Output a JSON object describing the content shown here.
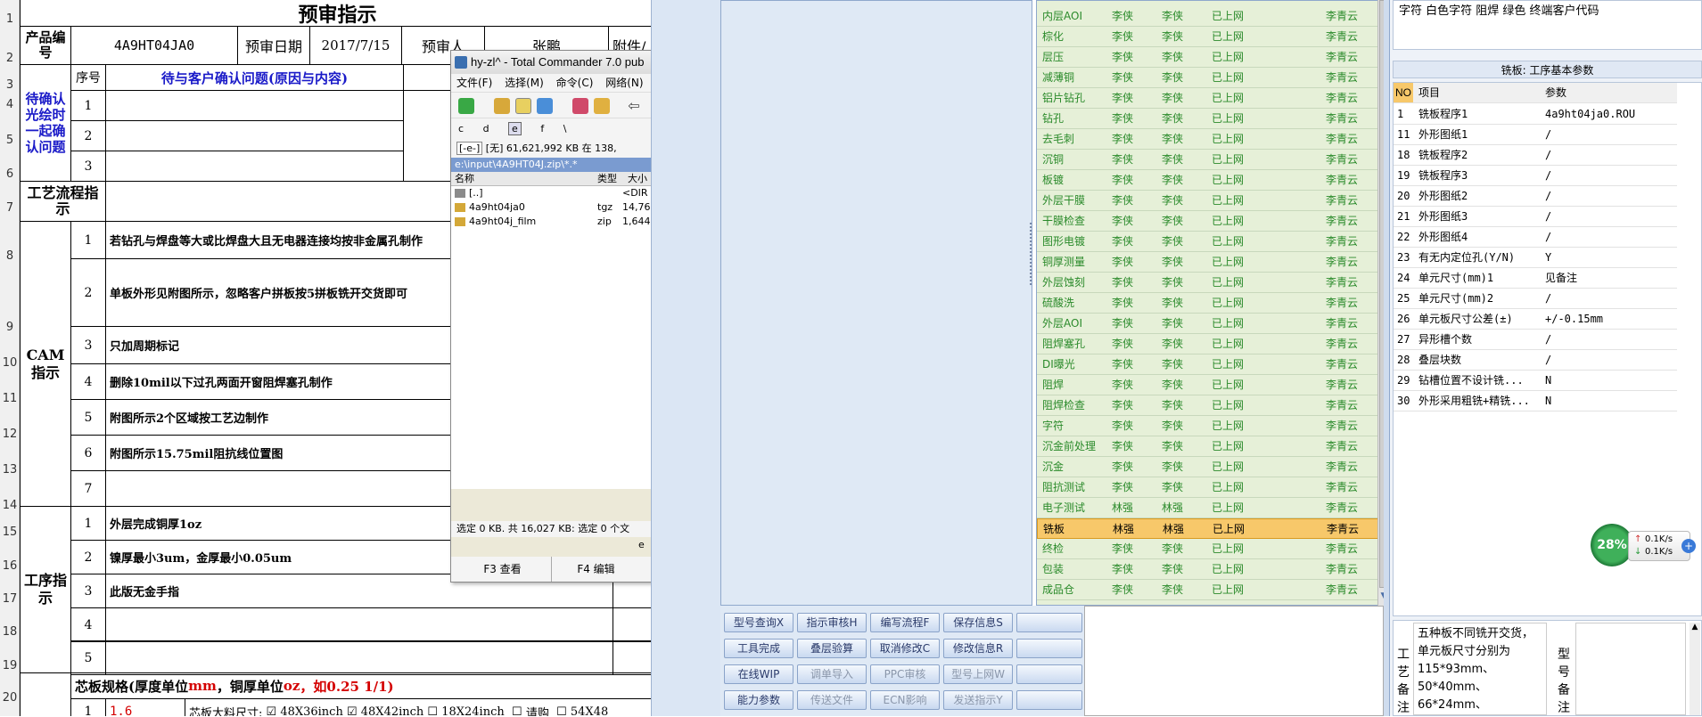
{
  "sheet": {
    "title": "预审指示",
    "row_numbers": [
      "1",
      "2",
      "3",
      "4",
      "5",
      "6",
      "7",
      "8",
      "9",
      "10",
      "11",
      "12",
      "13",
      "14",
      "15",
      "16",
      "17",
      "18",
      "19",
      "20"
    ],
    "header": {
      "product_label": "产品编号",
      "product_value": "4A9HT04JA0",
      "date_label": "预审日期",
      "date_value": "2017/7/15",
      "reviewer_label": "预审人",
      "reviewer_value": "张鹏",
      "attachment_label": "附件/"
    },
    "confirm": {
      "section_label": "待确认光绘时一起确认问题",
      "seq_label": "序号",
      "issues_label": "待与客户确认问题(原因与内容)",
      "rows": [
        "1",
        "2",
        "3"
      ]
    },
    "flow_label": "工艺流程指示",
    "cam": {
      "label": "CAM指示",
      "items": [
        {
          "no": "1",
          "text": "若钻孔与焊盘等大或比焊盘大且无电器连接均按非金属孔制作"
        },
        {
          "no": "2",
          "text": "单板外形见附图所示，忽略客户拼板按5拼板铣开交货即可"
        },
        {
          "no": "3",
          "text": "只加周期标记"
        },
        {
          "no": "4",
          "text": "删除10mil以下过孔两面开窗阻焊塞孔制作"
        },
        {
          "no": "5",
          "text": "附图所示2个区域按工艺边制作"
        },
        {
          "no": "6",
          "text": "附图所示15.75mil阻抗线位置图"
        },
        {
          "no": "7",
          "text": ""
        }
      ]
    },
    "process": {
      "label": "工序指示",
      "items": [
        {
          "no": "1",
          "text": "外层完成铜厚1oz"
        },
        {
          "no": "2",
          "text": "镍厚最小3um，金厚最小0.05um"
        },
        {
          "no": "3",
          "text": "此版无金手指"
        },
        {
          "no": "4",
          "text": ""
        },
        {
          "no": "5",
          "text": ""
        }
      ]
    },
    "core": {
      "prefix": "芯板规格(厚度单位",
      "mm": "mm",
      "mid": "，铜厚单位",
      "oz": "oz",
      "suffix": "，如0.25 1/1)",
      "no": "1",
      "thick": "1.6",
      "size_label": "芯板大料尺寸:",
      "opt1": "48X36inch",
      "opt2": "48X42inch",
      "opt3": "18X24inch",
      "opt4": "请购",
      "opt5": "54X48"
    }
  },
  "tc": {
    "title": "hy-zl^ - Total Commander 7.0 pub",
    "menu": [
      "文件(F)",
      "选择(M)",
      "命令(C)",
      "网络(N)"
    ],
    "drives": [
      "c",
      "d",
      "e",
      "f",
      "\\"
    ],
    "drive_select": "[-e-]",
    "info": "[无] 61,621,992 KB 在 138,",
    "path": "e:\\input\\4A9HT04J.zip\\*.*",
    "columns": {
      "name": "名称",
      "type": "类型",
      "size": "大小"
    },
    "files": [
      {
        "name": "[..]",
        "type": "",
        "size": "<DIR"
      },
      {
        "name": "4a9ht04ja0",
        "type": "tgz",
        "size": "14,768"
      },
      {
        "name": "4a9ht04j_film",
        "type": "zip",
        "size": "1,644"
      }
    ],
    "status": "选定 0 KB. 共 16,027 KB: 选定 0 个文",
    "status2": "e",
    "f3": "F3 查看",
    "f4": "F4 编辑"
  },
  "grid": {
    "rows": [
      [
        "内层AOI",
        "李侠",
        "李侠",
        "已上网",
        "李青云"
      ],
      [
        "棕化",
        "李侠",
        "李侠",
        "已上网",
        "李青云"
      ],
      [
        "层压",
        "李侠",
        "李侠",
        "已上网",
        "李青云"
      ],
      [
        "减薄铜",
        "李侠",
        "李侠",
        "已上网",
        "李青云"
      ],
      [
        "铝片钻孔",
        "李侠",
        "李侠",
        "已上网",
        "李青云"
      ],
      [
        "钻孔",
        "李侠",
        "李侠",
        "已上网",
        "李青云"
      ],
      [
        "去毛刺",
        "李侠",
        "李侠",
        "已上网",
        "李青云"
      ],
      [
        "沉铜",
        "李侠",
        "李侠",
        "已上网",
        "李青云"
      ],
      [
        "板镀",
        "李侠",
        "李侠",
        "已上网",
        "李青云"
      ],
      [
        "外层干膜",
        "李侠",
        "李侠",
        "已上网",
        "李青云"
      ],
      [
        "干膜检查",
        "李侠",
        "李侠",
        "已上网",
        "李青云"
      ],
      [
        "图形电镀",
        "李侠",
        "李侠",
        "已上网",
        "李青云"
      ],
      [
        "铜厚测量",
        "李侠",
        "李侠",
        "已上网",
        "李青云"
      ],
      [
        "外层蚀刻",
        "李侠",
        "李侠",
        "已上网",
        "李青云"
      ],
      [
        "硫酸洗",
        "李侠",
        "李侠",
        "已上网",
        "李青云"
      ],
      [
        "外层AOI",
        "李侠",
        "李侠",
        "已上网",
        "李青云"
      ],
      [
        "阻焊塞孔",
        "李侠",
        "李侠",
        "已上网",
        "李青云"
      ],
      [
        "DI曝光",
        "李侠",
        "李侠",
        "已上网",
        "李青云"
      ],
      [
        "阻焊",
        "李侠",
        "李侠",
        "已上网",
        "李青云"
      ],
      [
        "阻焊检查",
        "李侠",
        "李侠",
        "已上网",
        "李青云"
      ],
      [
        "字符",
        "李侠",
        "李侠",
        "已上网",
        "李青云"
      ],
      [
        "沉金前处理",
        "李侠",
        "李侠",
        "已上网",
        "李青云"
      ],
      [
        "沉金",
        "李侠",
        "李侠",
        "已上网",
        "李青云"
      ],
      [
        "阻抗测试",
        "李侠",
        "李侠",
        "已上网",
        "李青云"
      ],
      [
        "电子测试",
        "林强",
        "林强",
        "已上网",
        "李青云"
      ],
      [
        "铣板",
        "林强",
        "林强",
        "已上网",
        "李青云"
      ],
      [
        "终检",
        "李侠",
        "李侠",
        "已上网",
        "李青云"
      ],
      [
        "包装",
        "李侠",
        "李侠",
        "已上网",
        "李青云"
      ],
      [
        "成品仓",
        "李侠",
        "李侠",
        "已上网",
        "李青云"
      ]
    ],
    "selected_index": 25
  },
  "buttons": [
    [
      "型号查询X",
      "指示审核H",
      "编写流程F",
      "保存信息S",
      ""
    ],
    [
      "工具完成",
      "叠层验算",
      "取消修改C",
      "修改信息R",
      ""
    ],
    [
      "在线WIP",
      "调单导入",
      "PPC审核",
      "型号上网W",
      ""
    ],
    [
      "能力参数",
      "传送文件",
      "ECN影响",
      "发送指示Y",
      ""
    ]
  ],
  "buttons_disabled": [
    [
      false,
      false,
      false,
      false,
      false
    ],
    [
      false,
      false,
      false,
      false,
      false
    ],
    [
      false,
      true,
      true,
      true,
      false
    ],
    [
      false,
      true,
      true,
      true,
      false
    ]
  ],
  "right": {
    "top_text": "字符  白色字符  阻焊  绿色        终端客户代码",
    "title": "铣板: 工序基本参数",
    "col_no": "NO",
    "col_item": "项目",
    "col_param": "参数",
    "rows": [
      [
        "1",
        "铣板程序1",
        "4a9ht04ja0.ROU"
      ],
      [
        "11",
        "外形图纸1",
        "/"
      ],
      [
        "18",
        "铣板程序2",
        "/"
      ],
      [
        "19",
        "铣板程序3",
        "/"
      ],
      [
        "20",
        "外形图纸2",
        "/"
      ],
      [
        "21",
        "外形图纸3",
        "/"
      ],
      [
        "22",
        "外形图纸4",
        "/"
      ],
      [
        "23",
        "有无内定位孔(Y/N)",
        "Y"
      ],
      [
        "24",
        "单元尺寸(mm)1",
        "见备注"
      ],
      [
        "25",
        "单元尺寸(mm)2",
        "/"
      ],
      [
        "26",
        "单元板尺寸公差(±)",
        "+/-0.15mm"
      ],
      [
        "27",
        "异形槽个数",
        "/"
      ],
      [
        "28",
        "叠层块数",
        "/"
      ],
      [
        "29",
        "钻槽位置不设计铣...",
        "N"
      ],
      [
        "30",
        "外形采用粗铣+精铣...",
        "N"
      ]
    ],
    "remark_label": "工艺备注",
    "remark_text": "五种板不同铣开交货，单元板尺寸分别为115*93mm、50*40mm、66*24mm、",
    "model_label": "型号备注",
    "gauge": "28%",
    "net_up": "0.1K/s",
    "net_down": "0.1K/s"
  }
}
